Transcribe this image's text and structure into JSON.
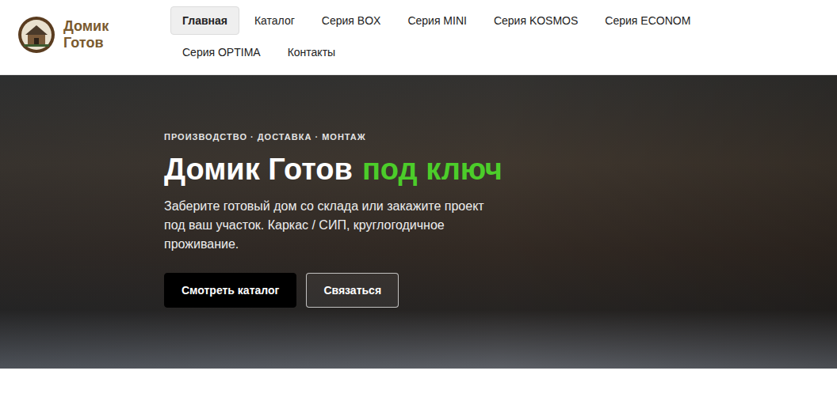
{
  "header": {
    "brand_lines": [
      "Домик",
      "Готов"
    ]
  },
  "nav": {
    "items": [
      {
        "label": "Главная",
        "selected": true
      },
      {
        "label": "Каталог",
        "selected": false
      },
      {
        "label": "Серия BOX",
        "selected": false
      },
      {
        "label": "Серия MINI",
        "selected": false
      },
      {
        "label": "Серия KOSMOS",
        "selected": false
      },
      {
        "label": "Серия ECONOM",
        "selected": false
      },
      {
        "label": "Серия OPTIMA",
        "selected": false
      },
      {
        "label": "Контакты",
        "selected": false
      }
    ]
  },
  "hero": {
    "eyebrow": "ПРОИЗВОДСТВО · ДОСТАВКА · МОНТАЖ",
    "title": "Домик Готов",
    "title_accent": "под ключ",
    "text": "Заберите готовый дом со склада или закажите проект под ваш участок. Каркас / СИП, круглогодичное проживание.",
    "buttons": [
      {
        "label": "Смотреть каталог",
        "kind": "primary"
      },
      {
        "label": "Связаться",
        "kind": "outline"
      }
    ]
  }
}
